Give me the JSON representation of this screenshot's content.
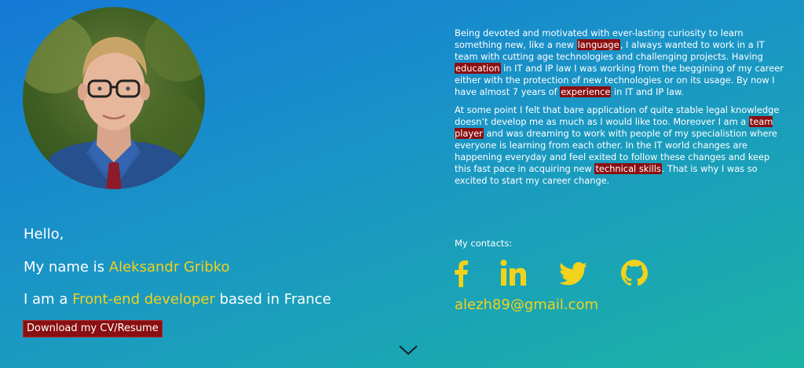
{
  "intro": {
    "hello": "Hello,",
    "name_prefix": "My name is ",
    "name": "Aleksandr Gribko",
    "role_prefix": "I am a ",
    "role": "Front-end developer",
    "role_suffix": " based in France",
    "cv_button": "Download my CV/Resume"
  },
  "about": {
    "p1": {
      "t1": "Being devoted and motivated with ever-lasting curiosity to learn something new, like a new ",
      "m1": "language",
      "t2": ", I always wanted to work in a IT team with cutting age technologies and challenging projects. Having ",
      "m2": "education",
      "t3": " in IT and IP law I was working from the beggining of my career either with the protection of new technologies or on its usage. By now I have almost 7 years of ",
      "m3": "experience",
      "t4": " in IT and IP law."
    },
    "p2": {
      "t1": "At some point I felt that bare application of quite stable legal knowledge doesn’t develop me as much as I would like too. Moreover I am a ",
      "m1": "team player",
      "t2": " and was dreaming to work with people of my specialistion where everyone is learning from each other. In the IT world changes are happening everyday and feel exited to follow these changes and keep this fast pace in acquiring new ",
      "m2": "technical skills",
      "t3": ". That is why I was so excited to start my career change."
    }
  },
  "contacts": {
    "label": "My contacts:",
    "icons": [
      "facebook-icon",
      "linkedin-icon",
      "twitter-icon",
      "github-icon"
    ],
    "email": "alezh89@gmail.com"
  },
  "colors": {
    "accent": "#f2d21a",
    "highlight": "#8a0f12",
    "gradient_start": "#1479d6",
    "gradient_end": "#1bb3a5"
  }
}
